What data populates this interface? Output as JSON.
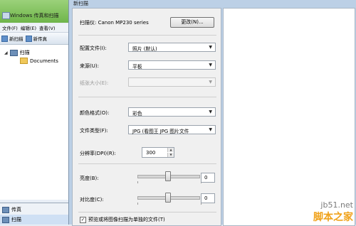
{
  "bg_window": {
    "title": "Windows 传真和扫描",
    "menu": [
      "文件(F)",
      "编辑(E)",
      "查看(V)"
    ],
    "toolbar": [
      "新扫描",
      "新传真"
    ],
    "tree": {
      "root": "扫描",
      "child": "Documents"
    },
    "nav": [
      {
        "label": "传真"
      },
      {
        "label": "扫描"
      }
    ]
  },
  "dialog": {
    "title": "新扫描",
    "scanner_label": "扫描仪: Canon MP230 series",
    "change_button": "更改(N)...",
    "profile_label": "配置文件(I):",
    "profile_value": "照片 (默认)",
    "source_label": "来源(U):",
    "source_value": "平板",
    "paper_label": "纸张大小(E):",
    "paper_value": "",
    "color_label": "颜色格式(O):",
    "color_value": "彩色",
    "filetype_label": "文件类型(F):",
    "filetype_value": "JPG (看图王 JPG 图片文件",
    "dpi_label": "分辨率(DPI)(R):",
    "dpi_value": "300",
    "brightness_label": "亮度(B):",
    "brightness_value": "0",
    "contrast_label": "对比度(C):",
    "contrast_value": "0",
    "separate_files_label": "预览或将图像扫描为单独的文件(T)"
  },
  "watermark": {
    "line1": "jb51.net",
    "line2": "脚本之家"
  }
}
